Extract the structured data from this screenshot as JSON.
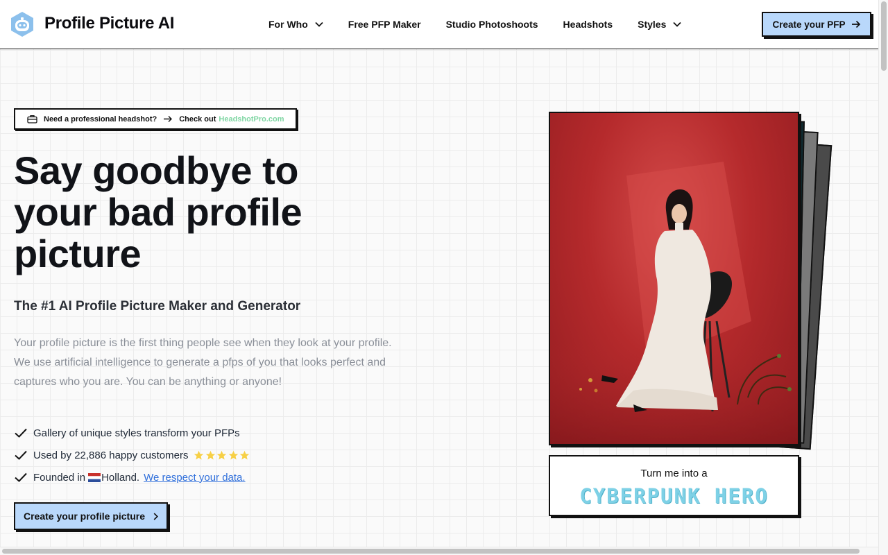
{
  "header": {
    "brand": "Profile Picture AI",
    "nav": [
      {
        "label": "For Who",
        "has_dropdown": true
      },
      {
        "label": "Free PFP Maker",
        "has_dropdown": false
      },
      {
        "label": "Studio Photoshoots",
        "has_dropdown": false
      },
      {
        "label": "Headshots",
        "has_dropdown": false
      },
      {
        "label": "Styles",
        "has_dropdown": true
      }
    ],
    "cta_label": "Create your PFP"
  },
  "hero": {
    "badge": {
      "question": "Need a professional headshot?",
      "check_out": "Check out",
      "link": "HeadshotPro.com"
    },
    "title_lines": [
      "Say goodbye to",
      "your bad profile",
      "picture"
    ],
    "subtitle": "The #1 AI Profile Picture Maker and Generator",
    "description": "Your profile picture is the first thing people see when they look at your profile. We use artificial intelligence to generate a pfps of you that looks perfect and captures who you are. You can be anything or anyone!",
    "features": {
      "gallery": "Gallery of unique styles transform your PFPs",
      "customers": "Used by 22,886 happy customers",
      "founded_prefix": "Founded in",
      "founded_place": "Holland.",
      "data_link": "We respect your data."
    },
    "rating_stars": 5,
    "cta_label": "Create your profile picture"
  },
  "showcase": {
    "turn_label": "Turn me into a",
    "style_word": "CYBERPUNK HERO"
  },
  "colors": {
    "accent_button": "#b9d8fb",
    "link_green": "#7fd6a3",
    "link_blue": "#2f6fdb",
    "photo_red": "#b52a2c",
    "cyber_text": "#7ed1e6",
    "star_yellow": "#f7d046"
  }
}
